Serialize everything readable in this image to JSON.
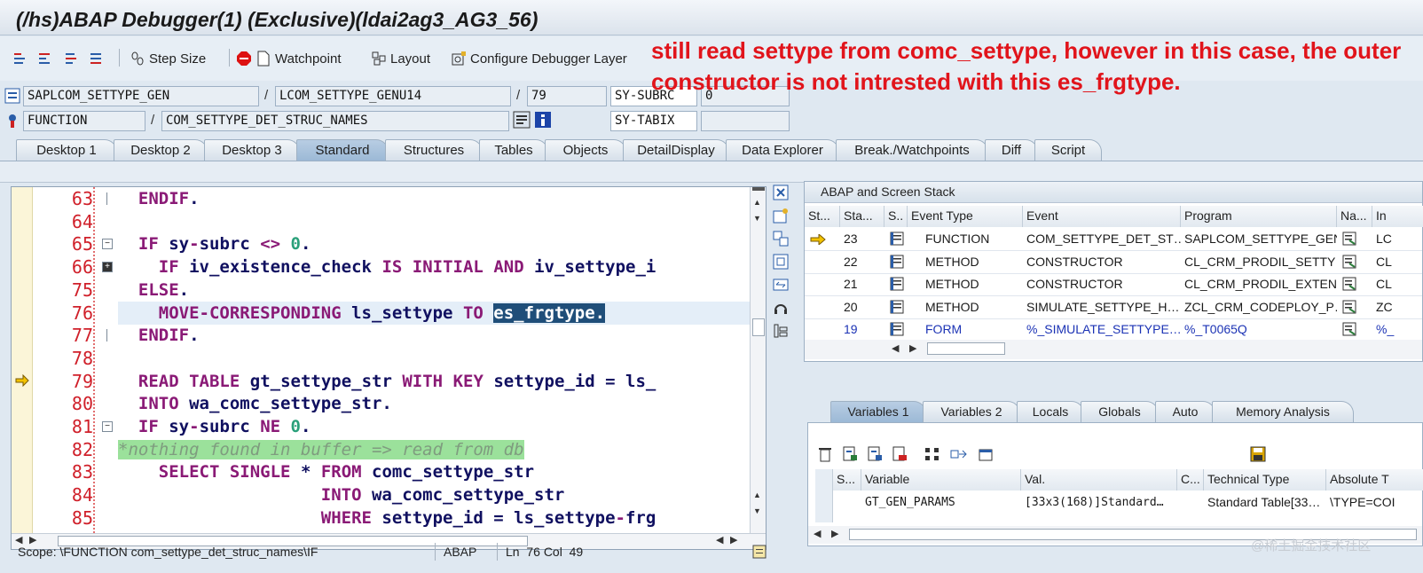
{
  "window": {
    "title": "(/hs)ABAP Debugger(1)  (Exclusive)(ldai2ag3_AG3_56)"
  },
  "toolbar": {
    "step_size": "Step Size",
    "watchpoint": "Watchpoint",
    "layout": "Layout",
    "configure": "Configure Debugger Layer"
  },
  "annotation": {
    "text": "still read settype from comc_settype, however in this case, the outer constructor is not intrested with this es_frgtype.",
    "color": "#e1141b"
  },
  "fields": {
    "program": "SAPLCOM_SETTYPE_GEN",
    "include": "LCOM_SETTYPE_GENU14",
    "line": "79",
    "subrc_label": "SY-SUBRC",
    "subrc_value": "0",
    "event_type": "FUNCTION",
    "event": "COM_SETTYPE_DET_STRUC_NAMES",
    "tabix_label": "SY-TABIX",
    "tabix_value": ""
  },
  "tabs": [
    "Desktop 1",
    "Desktop 2",
    "Desktop 3",
    "Standard",
    "Structures",
    "Tables",
    "Objects",
    "DetailDisplay",
    "Data Explorer",
    "Break./Watchpoints",
    "Diff",
    "Script"
  ],
  "active_tab": "Standard",
  "editor": {
    "lines": [
      {
        "n": "63",
        "code": "  ENDIF."
      },
      {
        "n": "64",
        "code": ""
      },
      {
        "n": "65",
        "code": "  IF sy-subrc <> 0."
      },
      {
        "n": "66",
        "code": "    IF iv_existence_check IS INITIAL AND iv_settype_i"
      },
      {
        "n": "75",
        "code": "  ELSE."
      },
      {
        "n": "76",
        "code": "    MOVE-CORRESPONDING ls_settype TO es_frgtype."
      },
      {
        "n": "77",
        "code": "  ENDIF."
      },
      {
        "n": "78",
        "code": ""
      },
      {
        "n": "79",
        "code": "  READ TABLE gt_settype_str WITH KEY settype_id = ls_"
      },
      {
        "n": "80",
        "code": "  INTO wa_comc_settype_str."
      },
      {
        "n": "81",
        "code": "  IF sy-subrc NE 0."
      },
      {
        "n": "82",
        "code": "*nothing found in buffer => read from db"
      },
      {
        "n": "83",
        "code": "    SELECT SINGLE * FROM comc_settype_str"
      },
      {
        "n": "84",
        "code": "                    INTO wa_comc_settype_str"
      },
      {
        "n": "85",
        "code": "                    WHERE settype_id = ls_settype-frg"
      }
    ],
    "current_line": "79"
  },
  "status": {
    "scope": "Scope: \\FUNCTION com_settype_det_struc_names\\IF",
    "lang": "ABAP",
    "pos": "Ln  76 Col  49"
  },
  "stack": {
    "title": "ABAP and Screen Stack",
    "columns": [
      "St...",
      "Sta...",
      "S..",
      "Event Type",
      "Event",
      "Program",
      "Na...",
      "In"
    ],
    "rows": [
      {
        "level": "23",
        "type": "FUNCTION",
        "event": "COM_SETTYPE_DET_ST…",
        "program": "SAPLCOM_SETTYPE_GEN",
        "inc": "LC",
        "current": true
      },
      {
        "level": "22",
        "type": "METHOD",
        "event": "CONSTRUCTOR",
        "program": "CL_CRM_PRODIL_SETTY…",
        "inc": "CL"
      },
      {
        "level": "21",
        "type": "METHOD",
        "event": "CONSTRUCTOR",
        "program": "CL_CRM_PRODIL_EXTEN…",
        "inc": "CL"
      },
      {
        "level": "20",
        "type": "METHOD",
        "event": "SIMULATE_SETTYPE_H…",
        "program": "ZCL_CRM_CODEPLOY_P…",
        "inc": "ZC"
      },
      {
        "level": "19",
        "type": "FORM",
        "event": "%_SIMULATE_SETTYPE…",
        "program": "%_T0065Q",
        "inc": "%_",
        "blue": true
      }
    ]
  },
  "vartabs": [
    "Variables 1",
    "Variables 2",
    "Locals",
    "Globals",
    "Auto",
    "Memory Analysis"
  ],
  "active_vartab": "Variables 1",
  "vars": {
    "columns": [
      "S...",
      "Variable",
      "Val.",
      "C...",
      "Technical Type",
      "Absolute T"
    ],
    "rows": [
      {
        "variable": "GT_GEN_PARAMS",
        "value": "[33x3(168)]Standard…",
        "c": "",
        "tech": "Standard Table[33…",
        "abs": "\\TYPE=COI"
      }
    ]
  },
  "watermark": "@稀土掘金技术社区"
}
